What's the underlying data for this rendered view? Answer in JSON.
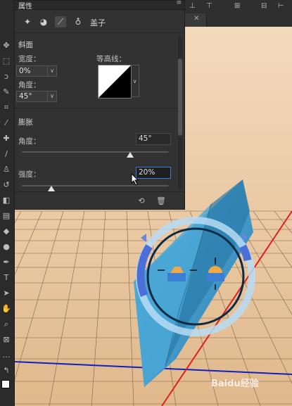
{
  "panel": {
    "title": "属性",
    "collapse_icon": "double-chevron-icon",
    "tabs": {
      "active_label": "盖子"
    },
    "bevel": {
      "section_title": "斜面",
      "width_label": "宽度：",
      "width_value": "0%",
      "angle_label": "角度：",
      "angle_value": "45°",
      "contour_label": "等高线："
    },
    "inflate": {
      "section_title": "膨胀",
      "angle_label": "角度：",
      "angle_value": "45°",
      "angle_slider_value": 0.74,
      "strength_label": "强度：",
      "strength_value": "20%",
      "strength_slider_value": 0.2
    }
  },
  "colors": {
    "shape_blue": "#3f9ccc",
    "gizmo_blue": "#4a6fd8",
    "gizmo_light": "#b7dcf5",
    "floor": "#e6c8a0",
    "axis_red": "#e02020",
    "axis_blue": "#1020c0"
  },
  "watermark": {
    "text": "Baidu经验"
  }
}
